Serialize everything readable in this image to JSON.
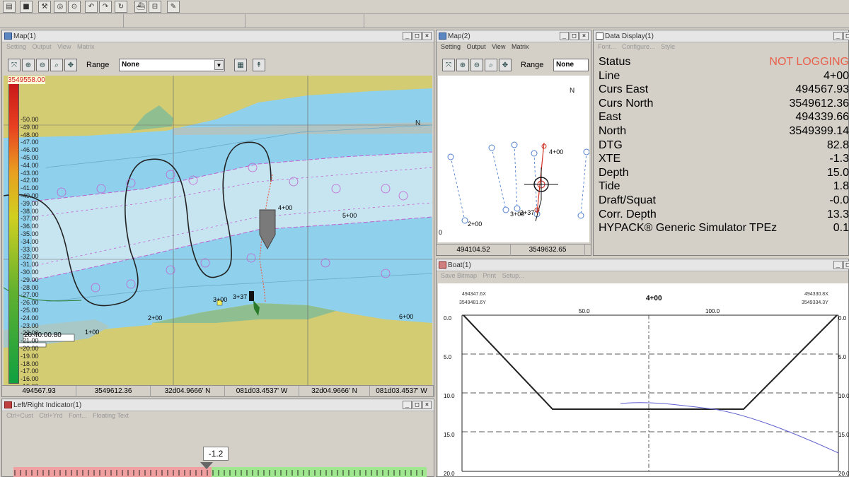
{
  "map1": {
    "title": "Map(1)",
    "menu": [
      "Setting",
      "Output",
      "View",
      "Matrix"
    ],
    "range_label": "Range",
    "range_value": "None",
    "scale_top": "3549558.00",
    "scale_labels": [
      "50.00",
      "49.00",
      "48.00",
      "47.00",
      "46.00",
      "45.00",
      "44.00",
      "43.00",
      "42.00",
      "41.00",
      "40.00",
      "39.00",
      "38.00",
      "37.00",
      "36.00",
      "35.00",
      "34.00",
      "33.00",
      "32.00",
      "31.00",
      "30.00",
      "29.00",
      "28.00",
      "27.00",
      "26.00",
      "25.00",
      "24.00",
      "23.00",
      "22.00",
      "21.00",
      "20.00",
      "19.00",
      "18.00",
      "17.00",
      "16.00",
      "15.00",
      "14.00",
      "13.00"
    ],
    "labels": {
      "l1": "1+00",
      "l2": "2+00",
      "l3": "3+00",
      "l3b": "3+37",
      "l4": "4+00",
      "l5": "5+00",
      "l6": "6+00",
      "box": "20:40:00.80"
    },
    "north": "N",
    "status": [
      "494567.93",
      "3549612.36",
      "32d04.9666' N",
      "081d03.4537' W",
      "32d04.9666' N",
      "081d03.4537' W"
    ]
  },
  "map2": {
    "title": "Map(2)",
    "menu": [
      "Setting",
      "Output",
      "View",
      "Matrix"
    ],
    "range_label": "Range",
    "range_value": "None",
    "labels": {
      "l2": "2+00",
      "l3": "3+00",
      "l3b": "3+37",
      "l4": "4+00",
      "zero": "0"
    },
    "north": "N",
    "status": [
      "494104.52",
      "3549632.65"
    ]
  },
  "data_display": {
    "title": "Data Display(1)",
    "menu": [
      "Font...",
      "Configure...",
      "Style"
    ],
    "rows": [
      {
        "k": "Status",
        "v": "NOT LOGGING",
        "alert": true
      },
      {
        "k": "Line",
        "v": "4+00"
      },
      {
        "k": "Curs East",
        "v": "494567.93"
      },
      {
        "k": "Curs North",
        "v": "3549612.36"
      },
      {
        "k": "East",
        "v": "494339.66"
      },
      {
        "k": "North",
        "v": "3549399.14"
      },
      {
        "k": "DTG",
        "v": "82.8"
      },
      {
        "k": "XTE",
        "v": "-1.3"
      },
      {
        "k": "Depth",
        "v": "15.0"
      },
      {
        "k": "Tide",
        "v": "1.8"
      },
      {
        "k": "Draft/Squat",
        "v": "-0.0"
      },
      {
        "k": "Corr. Depth",
        "v": "13.3"
      },
      {
        "k": "HYPACK® Generic Simulator TPEz",
        "v": "0.1"
      }
    ]
  },
  "boat": {
    "title": "Boat(1)",
    "menu": [
      "Save Bitmap",
      "Print",
      "Setup..."
    ],
    "line_label": "4+00",
    "left_x": "494347.6X",
    "left_y": "3549481.6Y",
    "right_x": "494330.8X",
    "right_y": "3549334.3Y",
    "x_ticks": [
      "50.0",
      "100.0"
    ],
    "y_ticks": [
      "0.0",
      "5.0",
      "10.0",
      "15.0",
      "20.0"
    ]
  },
  "lr_indicator": {
    "title": "Left/Right Indicator(1)",
    "menu": [
      "Ctrl+Cust",
      "Ctrl+Yrd",
      "Font...",
      "Floating Text"
    ],
    "value": "-1.2",
    "value_fraction": 0.47
  },
  "colors": {
    "accent": "#e8604a",
    "water": "#8fd0ec",
    "land": "#d4cc72"
  }
}
